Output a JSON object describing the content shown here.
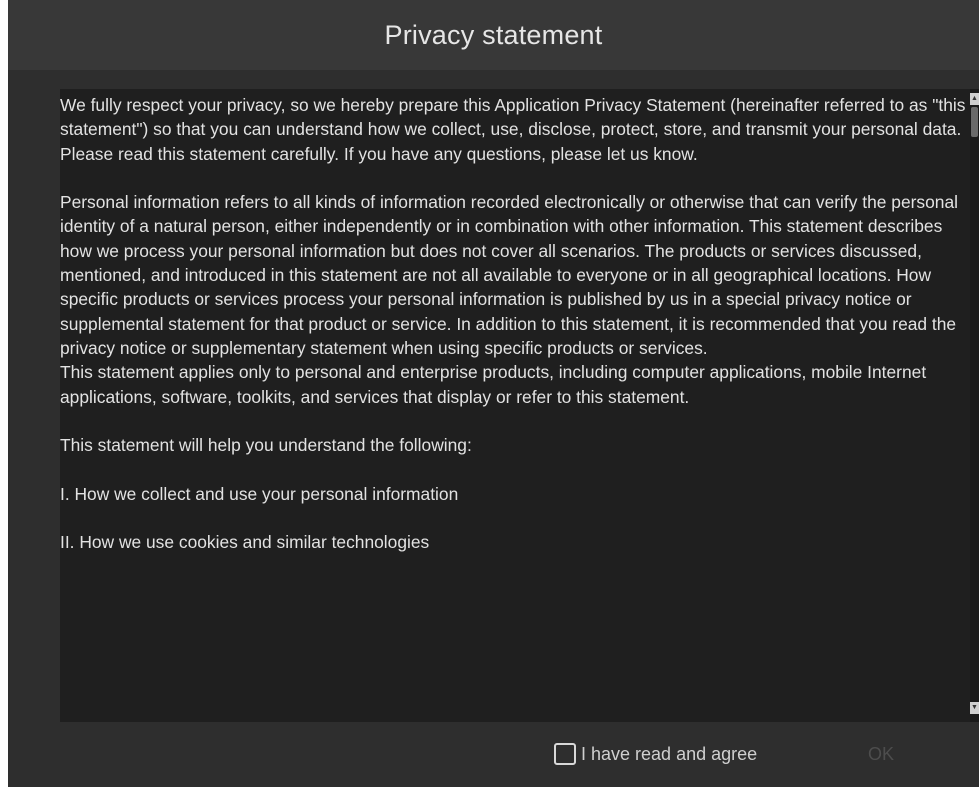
{
  "dialog": {
    "title": "Privacy statement"
  },
  "statement": {
    "paragraphs": [
      "We fully respect your privacy, so we hereby prepare this Application Privacy Statement (hereinafter referred to as \"this statement\") so that you can understand how we collect, use, disclose, protect, store, and transmit your personal data. Please read this statement carefully. If you have any questions, please let us know.",
      "Personal information refers to all kinds of information recorded electronically or otherwise that can verify the personal identity of a natural person, either independently or in combination with other information. This statement describes how we process your personal information but does not cover all scenarios. The products or services discussed, mentioned, and introduced in this statement are not all available to everyone or in all geographical locations. How specific products or services process your personal information is published by us in a special privacy notice or supplemental statement for that product or service. In addition to this statement, it is recommended that you read the privacy notice or supplementary statement when using specific products or services.",
      "This statement applies only to personal and enterprise products, including computer applications, mobile Internet applications, software, toolkits, and services that display or refer to this statement.",
      "This statement will help you understand the following:",
      "I. How we collect and use your personal information",
      "II. How we use cookies and similar technologies"
    ]
  },
  "footer": {
    "agree_label": "I have read and agree",
    "agree_checked": false,
    "ok_label": "OK"
  },
  "colors": {
    "dialog_bg": "#2e2e2e",
    "titlebar_bg": "#383838",
    "content_bg": "#1f1f1f",
    "text": "#e2e2e2",
    "ok_disabled": "#4d4d4d"
  },
  "icons": {
    "scroll_up": "triangle-up-icon",
    "scroll_down": "triangle-down-icon"
  }
}
